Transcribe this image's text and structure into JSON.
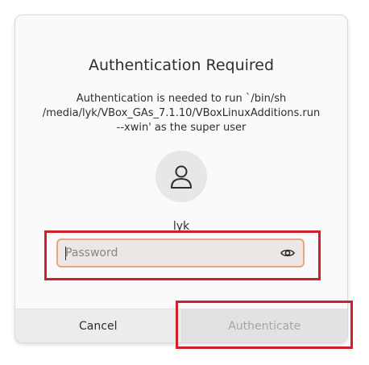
{
  "dialog": {
    "title": "Authentication Required",
    "message": "Authentication is needed to run `/bin/sh /media/lyk/VBox_GAs_7.1.10/VBoxLinuxAdditions.run --xwin' as the super user",
    "avatar_icon": "user-icon",
    "username": "lyk",
    "password_field": {
      "placeholder": "Password",
      "value": "",
      "reveal_icon": "eye-icon"
    },
    "buttons": {
      "cancel_label": "Cancel",
      "authenticate_label": "Authenticate",
      "authenticate_enabled": false
    }
  },
  "annotations": {
    "highlight_color": "#d0202a"
  },
  "colors": {
    "field_background": "#ece6e5",
    "field_focus_border": "#e8a77f",
    "disabled_text": "#a6a6a6"
  }
}
